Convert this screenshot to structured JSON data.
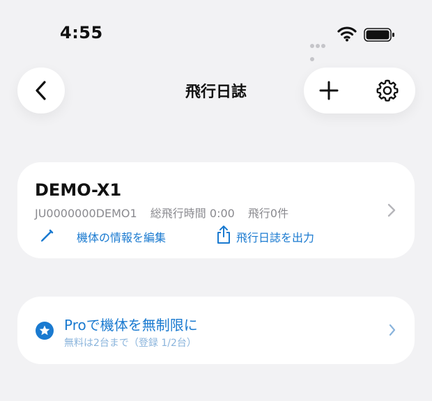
{
  "status": {
    "time": "4:55"
  },
  "nav": {
    "title": "飛行日誌"
  },
  "aircraft": {
    "name": "DEMO-X1",
    "registration": "JU0000000DEMO1",
    "total_time": "総飛行時間 0:00",
    "flight_count": "飛行0件",
    "edit_label": "機体の情報を編集",
    "export_label": "飛行日誌を出力"
  },
  "pro": {
    "title": "Proで機体を無制限に",
    "subtitle": "無料は2台まで（登録 1/2台）"
  },
  "colors": {
    "accent": "#1a7ad0",
    "background": "#f2f2f4",
    "card": "#ffffff"
  },
  "icons": [
    "back-chevron-icon",
    "plus-icon",
    "gear-icon",
    "chevron-right-icon",
    "pencil-icon",
    "share-icon",
    "star-icon",
    "wifi-icon",
    "battery-icon"
  ]
}
